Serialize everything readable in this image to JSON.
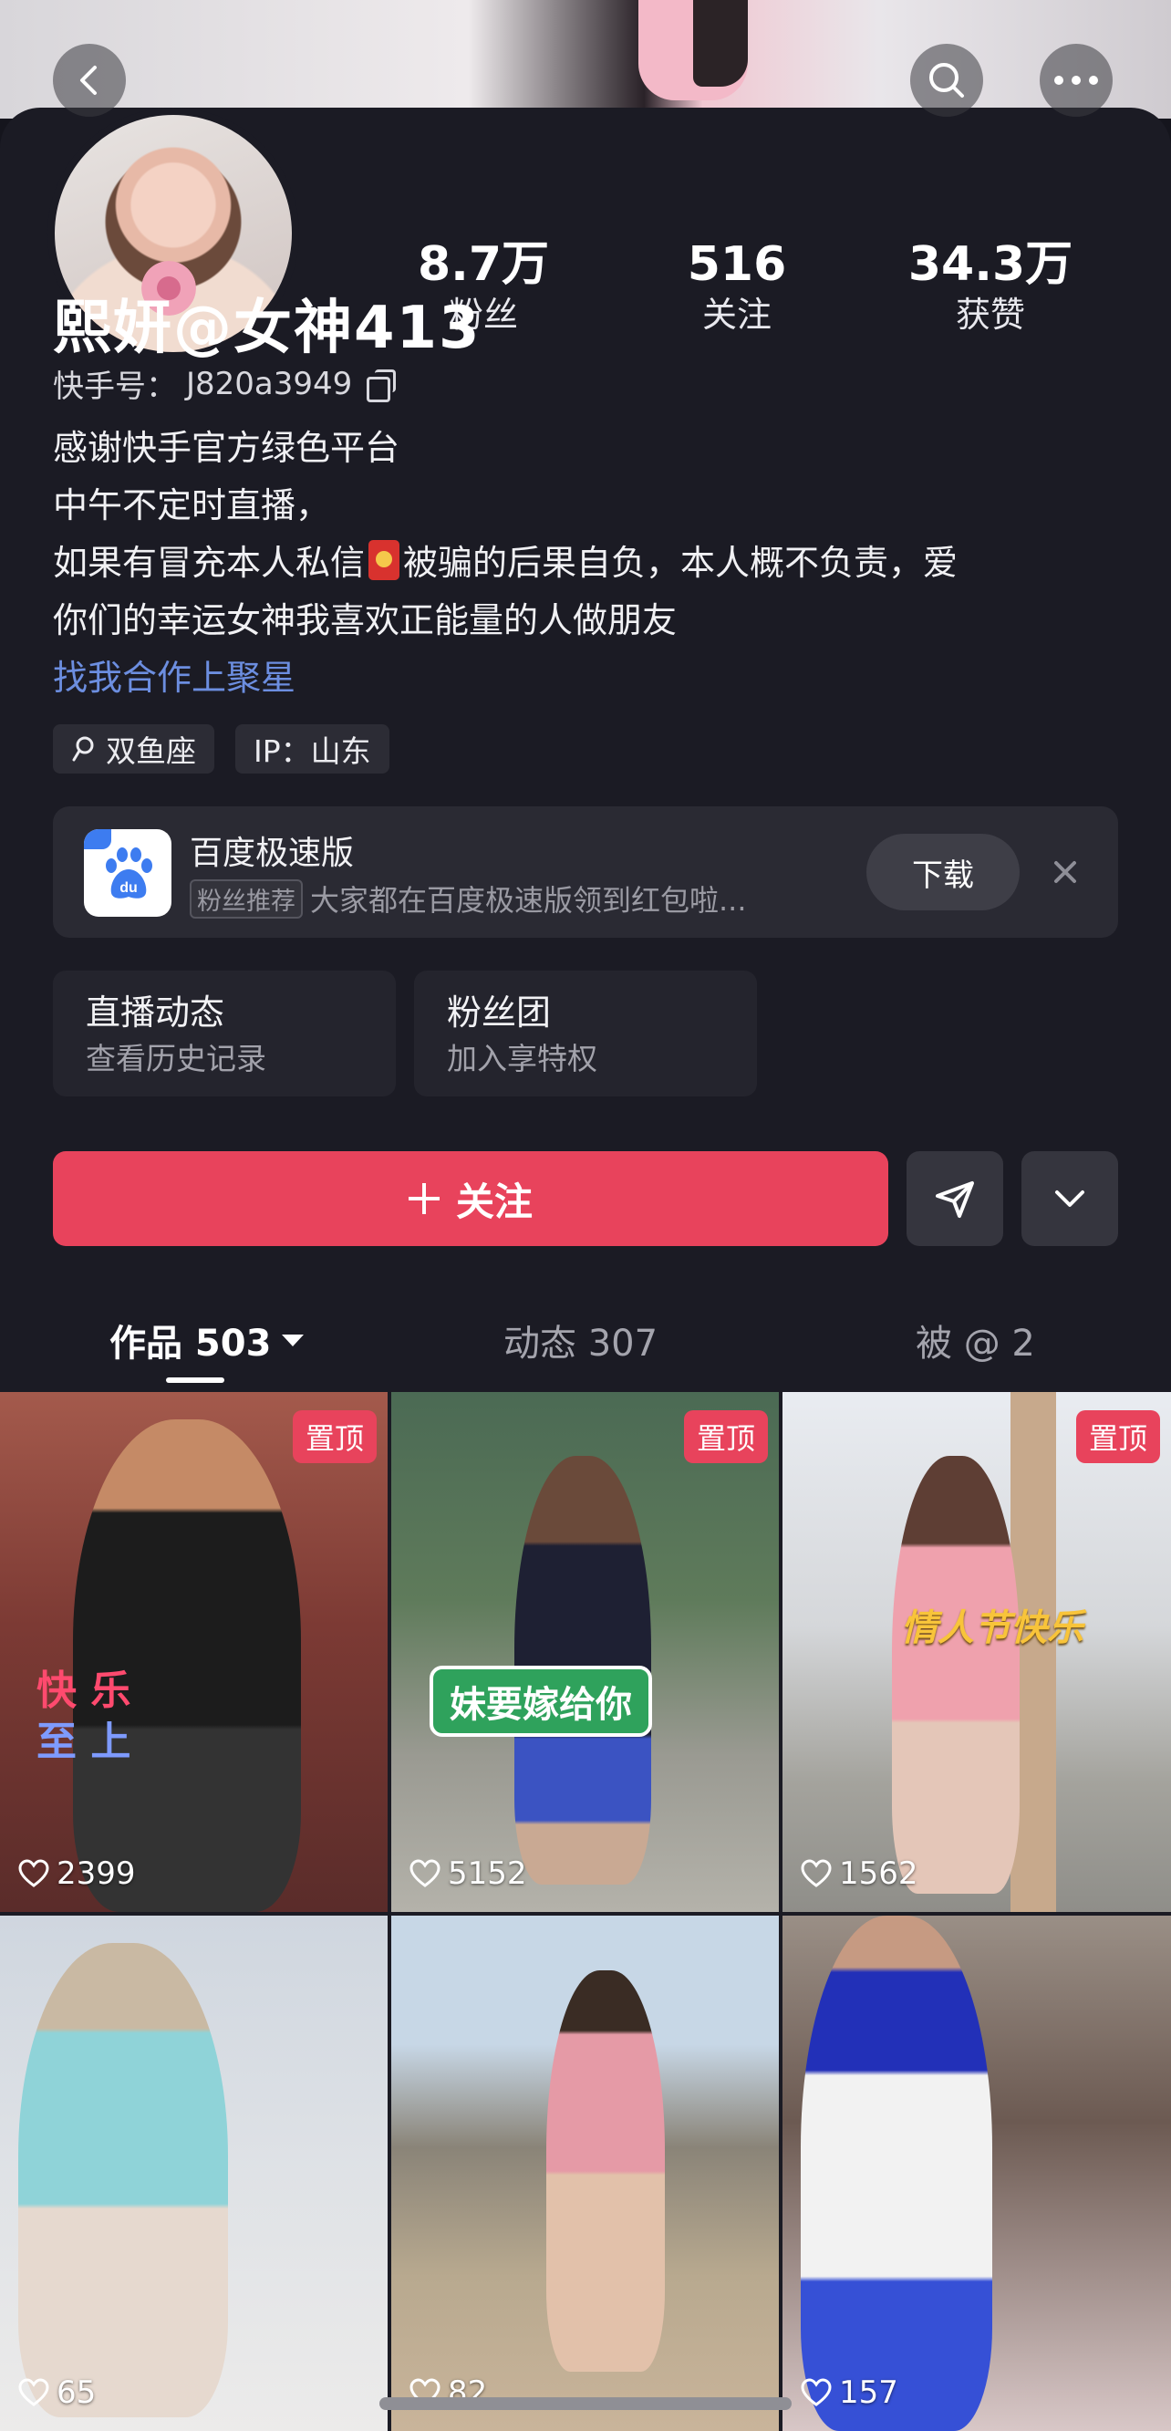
{
  "header": {
    "stats": [
      {
        "value": "8.7万",
        "label": "粉丝"
      },
      {
        "value": "516",
        "label": "关注"
      },
      {
        "value": "34.3万",
        "label": "获赞"
      }
    ]
  },
  "profile": {
    "name": "熙妍@女神413",
    "kuaishou_id_label": "快手号：",
    "kuaishou_id": "J820a3949",
    "bio_lines": [
      "感谢快手官方绿色平台",
      "中午不定时直播，",
      "如果有冒充本人私信",
      "被骗的后果自负，本人概不负责，爱",
      "你们的幸运女神我喜欢正能量的人做朋友"
    ],
    "cooperate_link": "找我合作上聚星",
    "tags": [
      "双鱼座",
      "IP：山东"
    ]
  },
  "ad": {
    "title": "百度极速版",
    "badge": "粉丝推荐",
    "text": "大家都在百度极速版领到红包啦...",
    "download_label": "下载",
    "logo_text": "du"
  },
  "entries": [
    {
      "title": "直播动态",
      "subtitle": "查看历史记录"
    },
    {
      "title": "粉丝团",
      "subtitle": "加入享特权"
    }
  ],
  "actions": {
    "follow_label": "关注"
  },
  "tabs": [
    {
      "label": "作品 503",
      "active": true
    },
    {
      "label": "动态 307",
      "active": false
    },
    {
      "label": "被 @ 2",
      "active": false
    }
  ],
  "grid": {
    "pinned_label": "置顶",
    "items": [
      {
        "likes": "2399",
        "pinned": true,
        "captions": [
          "快",
          "乐",
          "至",
          "上"
        ]
      },
      {
        "likes": "5152",
        "pinned": true,
        "caption": "妹要嫁给你"
      },
      {
        "likes": "1562",
        "pinned": true,
        "caption": "情人节快乐"
      },
      {
        "likes": "65",
        "pinned": false
      },
      {
        "likes": "82",
        "pinned": false
      },
      {
        "likes": "157",
        "pinned": false
      }
    ]
  },
  "colors": {
    "accent": "#e8435c",
    "link": "#6c8ee0",
    "background": "#1b1b24"
  }
}
